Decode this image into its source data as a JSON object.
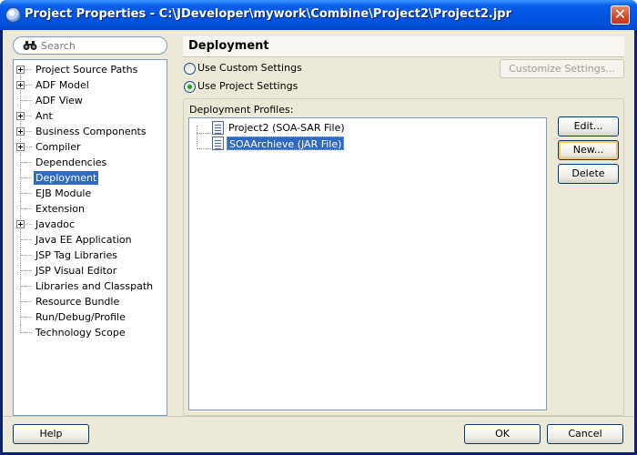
{
  "window": {
    "title": "Project Properties - C:\\JDeveloper\\mywork\\Combine\\Project2\\Project2.jpr",
    "close_glyph": "✕"
  },
  "search": {
    "placeholder": "Search",
    "icon": "binoculars-icon"
  },
  "tree": {
    "items": [
      {
        "label": "Project Source Paths",
        "expandable": true
      },
      {
        "label": "ADF Model",
        "expandable": true
      },
      {
        "label": "ADF View",
        "expandable": false
      },
      {
        "label": "Ant",
        "expandable": true
      },
      {
        "label": "Business Components",
        "expandable": true
      },
      {
        "label": "Compiler",
        "expandable": true
      },
      {
        "label": "Dependencies",
        "expandable": false
      },
      {
        "label": "Deployment",
        "expandable": false,
        "selected": true
      },
      {
        "label": "EJB Module",
        "expandable": false
      },
      {
        "label": "Extension",
        "expandable": false
      },
      {
        "label": "Javadoc",
        "expandable": true
      },
      {
        "label": "Java EE Application",
        "expandable": false
      },
      {
        "label": "JSP Tag Libraries",
        "expandable": false
      },
      {
        "label": "JSP Visual Editor",
        "expandable": false
      },
      {
        "label": "Libraries and Classpath",
        "expandable": false
      },
      {
        "label": "Resource Bundle",
        "expandable": false
      },
      {
        "label": "Run/Debug/Profile",
        "expandable": false
      },
      {
        "label": "Technology Scope",
        "expandable": false
      }
    ]
  },
  "panel": {
    "title": "Deployment",
    "radio_custom": "Use Custom Settings",
    "radio_project": "Use Project Settings",
    "selected_radio": "Use Project Settings",
    "customize_button": "Customize Settings...",
    "profiles_label": "Deployment Profiles:",
    "profiles": [
      {
        "label": "Project2 (SOA-SAR File)",
        "selected": false
      },
      {
        "label": "SOAArchieve (JAR File)",
        "selected": true
      }
    ],
    "edit_button": "Edit...",
    "new_button": "New...",
    "delete_button": "Delete"
  },
  "footer": {
    "help_button": "Help",
    "ok_button": "OK",
    "cancel_button": "Cancel"
  },
  "colors": {
    "selection": "#316ac5",
    "title_bar": "#0054e3",
    "dialog_bg": "#ece9d8"
  }
}
